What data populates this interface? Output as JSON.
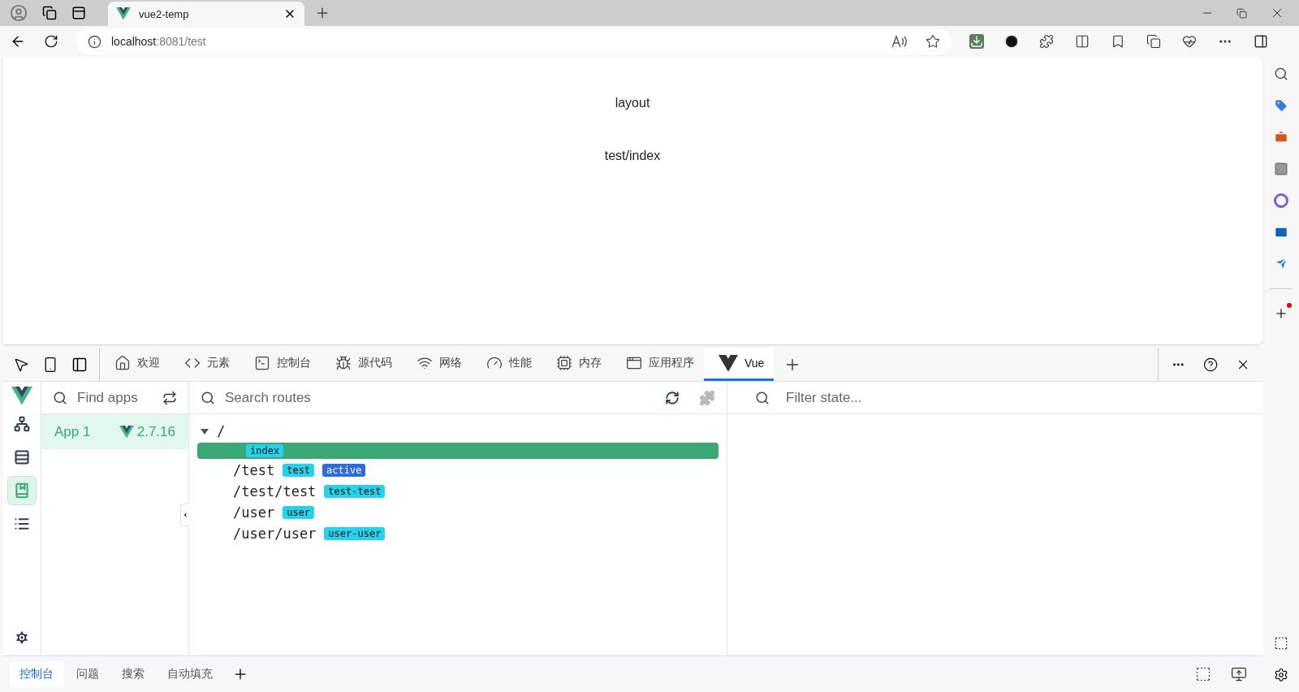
{
  "browser": {
    "tab_title": "vue2-temp",
    "address": {
      "host": "localhost",
      "path": ":8081/test"
    }
  },
  "page": {
    "lines": [
      "layout",
      "test/index"
    ]
  },
  "devtools": {
    "tabs": [
      {
        "kind": "welcome",
        "label": "欢迎",
        "selected": false
      },
      {
        "kind": "elements",
        "label": "元素",
        "selected": false
      },
      {
        "kind": "console",
        "label": "控制台",
        "selected": false
      },
      {
        "kind": "sources",
        "label": "源代码",
        "selected": false
      },
      {
        "kind": "network",
        "label": "网络",
        "selected": false
      },
      {
        "kind": "performance",
        "label": "性能",
        "selected": false
      },
      {
        "kind": "memory",
        "label": "内存",
        "selected": false
      },
      {
        "kind": "application",
        "label": "应用程序",
        "selected": false
      },
      {
        "kind": "vue",
        "label": "Vue",
        "selected": true
      }
    ],
    "vue": {
      "rail": [
        {
          "kind": "components",
          "selected": false
        },
        {
          "kind": "timeline",
          "selected": false
        },
        {
          "kind": "routes",
          "selected": true
        },
        {
          "kind": "settings-list",
          "selected": false
        }
      ],
      "apps_search": {
        "placeholder": "Find apps"
      },
      "apps": [
        {
          "name": "App 1",
          "version": "2.7.16",
          "selected": true
        }
      ],
      "routes_search": {
        "placeholder": "Search routes"
      },
      "routes": [
        {
          "path": "/",
          "expanded": true,
          "selected": false,
          "children": [
            {
              "selected": true,
              "tags": [
                {
                  "kind": "name",
                  "label": "index"
                }
              ]
            },
            {
              "path": "/test",
              "selected": false,
              "tags": [
                {
                  "kind": "name",
                  "label": "test"
                },
                {
                  "kind": "active",
                  "label": "active"
                }
              ]
            },
            {
              "path": "/test/test",
              "selected": false,
              "tags": [
                {
                  "kind": "name",
                  "label": "test-test"
                }
              ]
            },
            {
              "path": "/user",
              "selected": false,
              "tags": [
                {
                  "kind": "name",
                  "label": "user"
                }
              ]
            },
            {
              "path": "/user/user",
              "selected": false,
              "tags": [
                {
                  "kind": "name",
                  "label": "user-user"
                }
              ]
            }
          ]
        }
      ],
      "state_search": {
        "placeholder": "Filter state..."
      }
    }
  },
  "drawer": {
    "tabs": [
      {
        "label": "控制台",
        "selected": true
      },
      {
        "label": "问题",
        "selected": false
      },
      {
        "label": "搜索",
        "selected": false
      },
      {
        "label": "自动填充",
        "selected": false
      }
    ]
  }
}
